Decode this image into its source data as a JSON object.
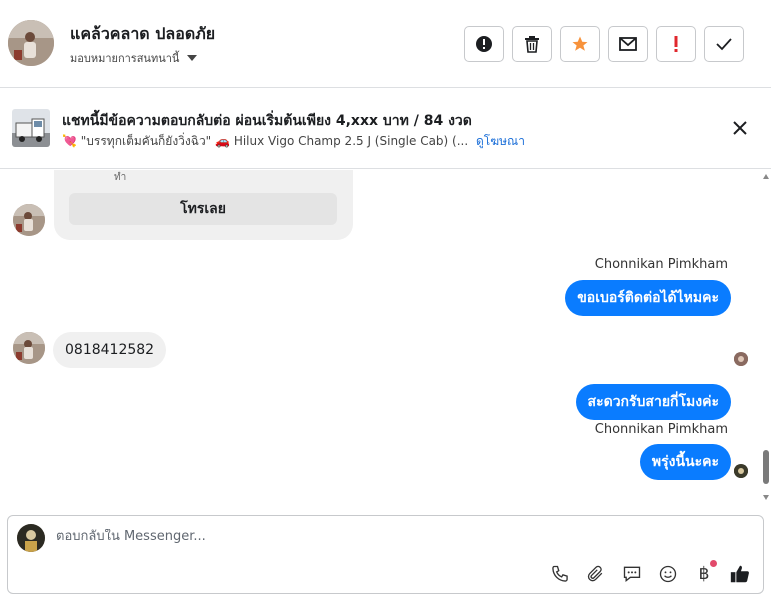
{
  "header": {
    "contact_name": "แคล้วคลาด ปลอดภัย",
    "assign_label": "มอบหมายการสนทนานี้",
    "actions": [
      {
        "name": "spam",
        "icon": "alert-circle-icon"
      },
      {
        "name": "delete",
        "icon": "trash-icon"
      },
      {
        "name": "star",
        "icon": "star-icon",
        "color": "#f7923b"
      },
      {
        "name": "email",
        "icon": "envelope-icon"
      },
      {
        "name": "important",
        "icon": "exclamation-icon",
        "color": "#e0282e"
      },
      {
        "name": "done",
        "icon": "check-icon"
      }
    ]
  },
  "banner": {
    "title": "แชทนี้มีข้อความตอบกลับต่อ ผ่อนเริ่มต้นเพียง 4,xxx บาท / 84 งวด",
    "subtitle": "\"บรรทุกเต็มคันก็ยังวิ่งฉิว\"",
    "model": "Hilux Vigo Champ 2.5 J (Single Cab) (...",
    "link": "ดูโฆษณา"
  },
  "messages": {
    "card_stub": "ทำ",
    "call_button": "โทรเลย",
    "sender_1": "Chonnikan Pimkham",
    "outgoing_1": "ขอเบอร์ติดต่อได้ไหมคะ",
    "incoming_1": "0818412582",
    "outgoing_2": "สะดวกรับสายกี่โมงค่ะ",
    "sender_2": "Chonnikan Pimkham",
    "outgoing_3": "พรุ่งนี้นะคะ"
  },
  "composer": {
    "placeholder": "ตอบกลับใน Messenger...",
    "tools": [
      "phone-icon",
      "paperclip-icon",
      "saved-reply-icon",
      "emoji-icon",
      "baht-icon",
      "thumbs-up-icon"
    ]
  },
  "colors": {
    "accent": "#0a7cff",
    "star": "#f7923b",
    "important": "#e0282e",
    "link": "#1a6ed8"
  }
}
